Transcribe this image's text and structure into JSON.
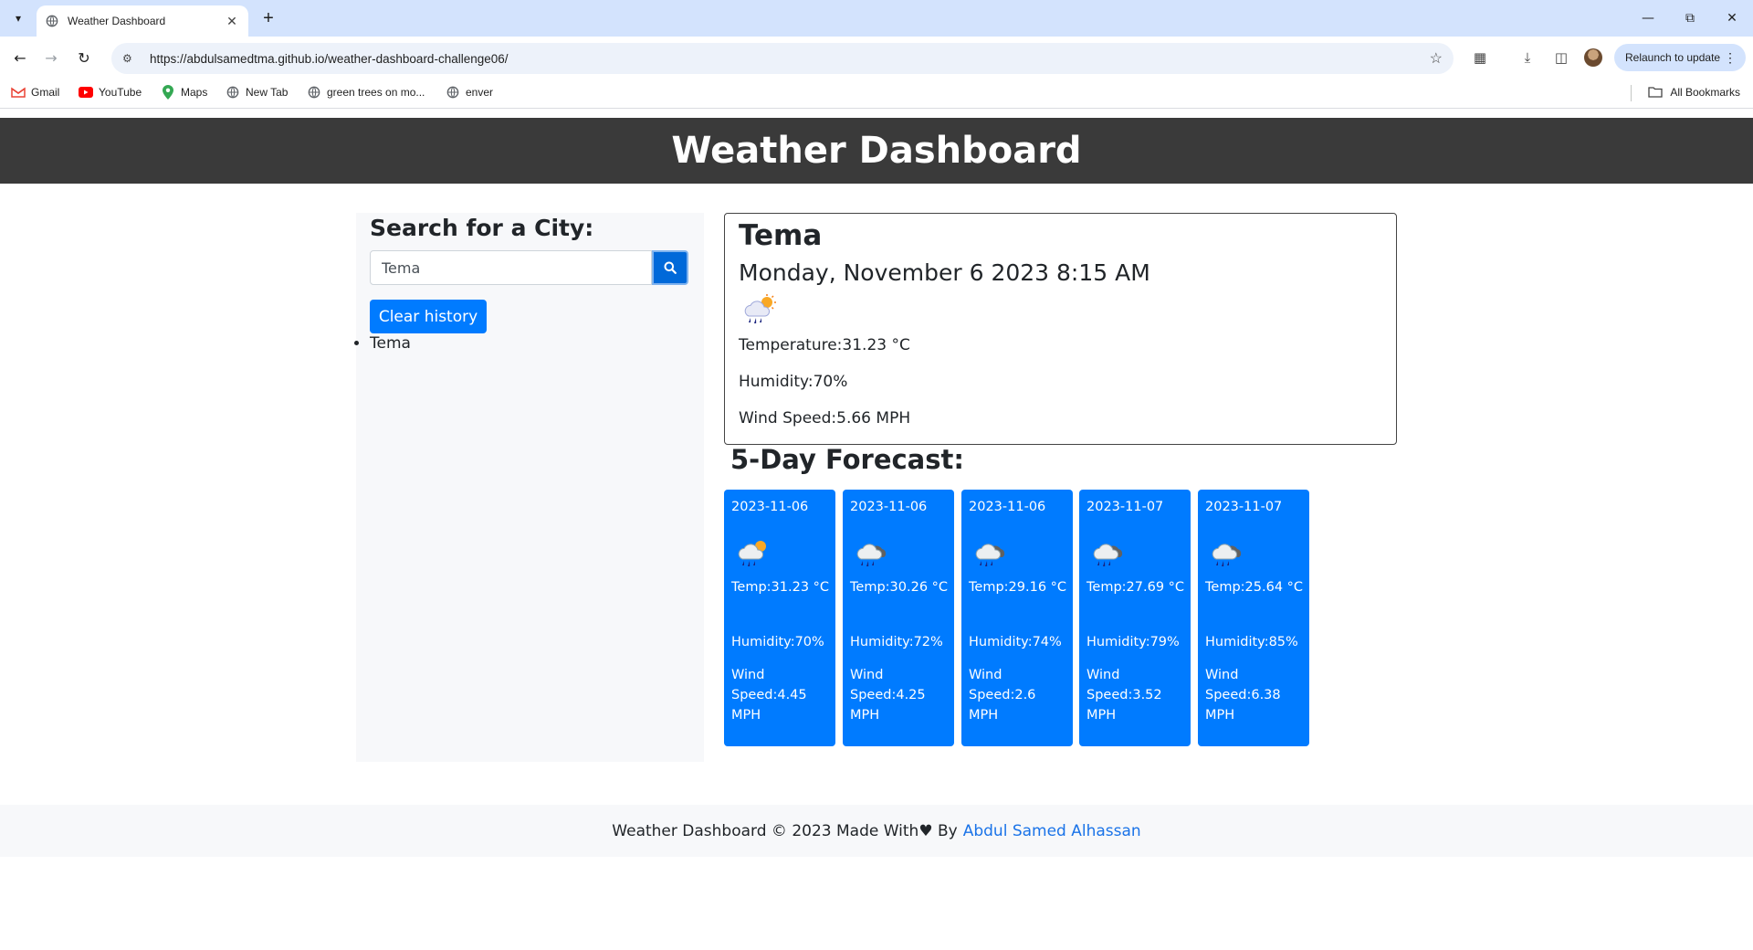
{
  "browser": {
    "tab_title": "Weather Dashboard",
    "url": "https://abdulsamedtma.github.io/weather-dashboard-challenge06/",
    "relaunch_label": "Relaunch to update",
    "bookmarks": [
      {
        "label": "Gmail",
        "icon": "gmail-icon"
      },
      {
        "label": "YouTube",
        "icon": "youtube-icon"
      },
      {
        "label": "Maps",
        "icon": "maps-icon"
      },
      {
        "label": "New Tab",
        "icon": "globe-icon"
      },
      {
        "label": "green trees on mo...",
        "icon": "globe-icon"
      },
      {
        "label": "enver",
        "icon": "globe-icon"
      }
    ],
    "all_bookmarks_label": "All Bookmarks"
  },
  "header": {
    "title": "Weather Dashboard"
  },
  "search": {
    "heading": "Search for a City:",
    "input_value": "Tema",
    "clear_label": "Clear history",
    "history": [
      "Tema"
    ]
  },
  "current": {
    "city": "Tema",
    "date": "Monday, November 6 2023 8:15 AM",
    "temperature": "Temperature:31.23 °C",
    "humidity": "Humidity:70%",
    "wind": "Wind Speed:5.66 MPH",
    "icon": "rain-sun-icon"
  },
  "forecast": {
    "title": "5-Day Forecast:",
    "days": [
      {
        "date": "2023-11-06",
        "temp": "Temp:31.23 °C",
        "humidity": "Humidity:70%",
        "wind": "Wind Speed:4.45 MPH",
        "icon": "rain-sun-icon"
      },
      {
        "date": "2023-11-06",
        "temp": "Temp:30.26 °C",
        "humidity": "Humidity:72%",
        "wind": "Wind Speed:4.25 MPH",
        "icon": "rain-cloud-icon"
      },
      {
        "date": "2023-11-06",
        "temp": "Temp:29.16 °C",
        "humidity": "Humidity:74%",
        "wind": "Wind Speed:2.6 MPH",
        "icon": "rain-cloud-icon"
      },
      {
        "date": "2023-11-07",
        "temp": "Temp:27.69 °C",
        "humidity": "Humidity:79%",
        "wind": "Wind Speed:3.52 MPH",
        "icon": "rain-cloud-icon"
      },
      {
        "date": "2023-11-07",
        "temp": "Temp:25.64 °C",
        "humidity": "Humidity:85%",
        "wind": "Wind Speed:6.38 MPH",
        "icon": "rain-cloud-icon"
      }
    ]
  },
  "footer": {
    "text": "Weather Dashboard © 2023 Made With♥ By",
    "author": "Abdul Samed Alhassan"
  },
  "colors": {
    "header_bg": "#3a3a3a",
    "card_blue": "#007bff",
    "search_btn": "#0069d9",
    "link": "#1a73e8"
  }
}
